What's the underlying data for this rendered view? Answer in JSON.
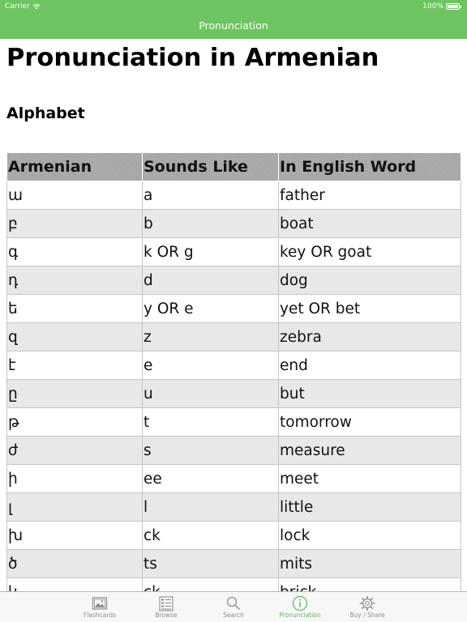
{
  "status_bar": {
    "carrier": "Carrier",
    "battery": "100%"
  },
  "nav": {
    "title": "Pronunciation"
  },
  "page": {
    "title": "Pronunciation in Armenian",
    "section_title": "Alphabet"
  },
  "table": {
    "headers": [
      "Armenian",
      "Sounds Like",
      "In English Word"
    ],
    "rows": [
      [
        "ա",
        "a",
        "father"
      ],
      [
        "բ",
        "b",
        "boat"
      ],
      [
        "գ",
        "k OR g",
        "key OR goat"
      ],
      [
        "դ",
        "d",
        "dog"
      ],
      [
        "ե",
        "y OR e",
        "yet OR bet"
      ],
      [
        "զ",
        "z",
        "zebra"
      ],
      [
        "է",
        "e",
        "end"
      ],
      [
        "ը",
        "u",
        "but"
      ],
      [
        "թ",
        "t",
        "tomorrow"
      ],
      [
        "ժ",
        "s",
        "measure"
      ],
      [
        "ի",
        "ee",
        "meet"
      ],
      [
        "լ",
        "l",
        "little"
      ],
      [
        "խ",
        "ck",
        "lock"
      ],
      [
        "ծ",
        "ts",
        "mits"
      ],
      [
        "կ",
        "ck",
        "brick"
      ]
    ]
  },
  "tabs": [
    {
      "label": "Flashcards",
      "icon": "image-icon",
      "active": false
    },
    {
      "label": "Browse",
      "icon": "list-icon",
      "active": false
    },
    {
      "label": "Search",
      "icon": "search-icon",
      "active": false
    },
    {
      "label": "Pronunciation",
      "icon": "info-icon",
      "active": true
    },
    {
      "label": "Buy / Share",
      "icon": "gear-icon",
      "active": false
    }
  ],
  "colors": {
    "header_bg": "#6cc560",
    "tab_active": "#5cb85c",
    "tab_inactive": "#8e8e8e",
    "table_header_bg": "#a8a8a8",
    "row_alt_bg": "#e8e8e8"
  }
}
